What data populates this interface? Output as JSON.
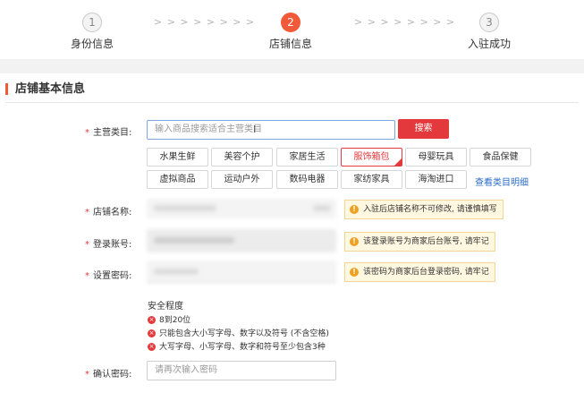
{
  "steps": [
    {
      "number": "1",
      "label": "身份信息",
      "active": false
    },
    {
      "number": "2",
      "label": "店铺信息",
      "active": true
    },
    {
      "number": "3",
      "label": "入驻成功",
      "active": false
    }
  ],
  "step_separator": "> > > > > > > >",
  "section": {
    "title": "店铺基本信息"
  },
  "category": {
    "label": "主营类目:",
    "required_mark": "*",
    "search_placeholder": "输入商品搜索适合主营类目",
    "search_button": "搜索",
    "items": [
      "水果生鲜",
      "美容个护",
      "家居生活",
      "服饰箱包",
      "母婴玩具",
      "食品保健",
      "虚拟商品",
      "运动户外",
      "数码电器",
      "家纺家具",
      "海淘进口"
    ],
    "selected": "服饰箱包",
    "detail_link": "查看类目明细"
  },
  "store_name": {
    "label": "店铺名称:",
    "required_mark": "*",
    "tip": "入驻后店铺名称不可修改, 请谨慎填写"
  },
  "login_account": {
    "label": "登录账号:",
    "required_mark": "*",
    "tip": "该登录账号为商家后台账号, 请牢记"
  },
  "password": {
    "label": "设置密码:",
    "required_mark": "*",
    "tip": "该密码为商家后台登录密码, 请牢记"
  },
  "password_strength": {
    "title": "安全程度",
    "rules": [
      "8到20位",
      "只能包含大小写字母、数字以及符号 (不含空格)",
      "大写字母、小写字母、数字和符号至少包含3种"
    ]
  },
  "confirm_password": {
    "label": "确认密码:",
    "required_mark": "*",
    "placeholder": "请再次输入密码"
  },
  "icons": {
    "tip": "exclamation-icon",
    "rule": "x-circle-icon",
    "cursor": "text-cursor-icon"
  },
  "colors": {
    "accent": "#e4393c",
    "step_active": "#f15a38",
    "link": "#2a6cc7",
    "tip_bg": "#fff8e1"
  }
}
